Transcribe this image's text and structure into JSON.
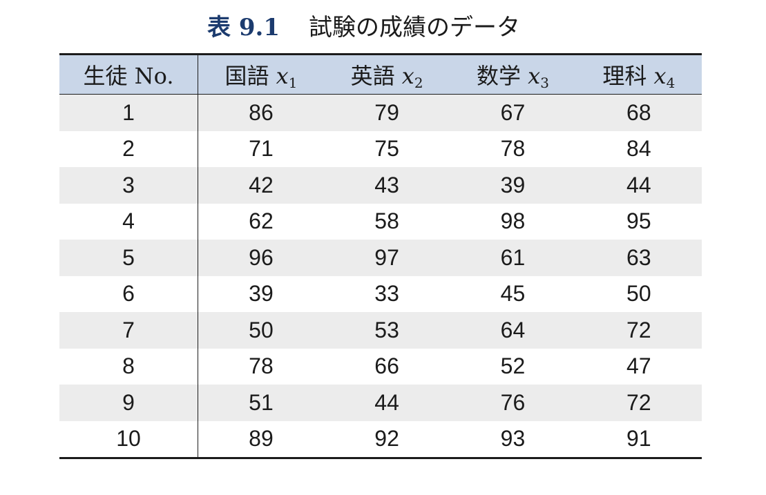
{
  "caption": {
    "label": "表",
    "number": "9.1",
    "title": "試験の成績のデータ"
  },
  "table": {
    "headers": [
      {
        "text": "生徒 No.",
        "var": "",
        "sub": ""
      },
      {
        "text": "国語 ",
        "var": "x",
        "sub": "1"
      },
      {
        "text": "英語 ",
        "var": "x",
        "sub": "2"
      },
      {
        "text": "数学 ",
        "var": "x",
        "sub": "3"
      },
      {
        "text": "理科 ",
        "var": "x",
        "sub": "4"
      }
    ],
    "rows": [
      [
        "1",
        "86",
        "79",
        "67",
        "68"
      ],
      [
        "2",
        "71",
        "75",
        "78",
        "84"
      ],
      [
        "3",
        "42",
        "43",
        "39",
        "44"
      ],
      [
        "4",
        "62",
        "58",
        "98",
        "95"
      ],
      [
        "5",
        "96",
        "97",
        "61",
        "63"
      ],
      [
        "6",
        "39",
        "33",
        "45",
        "50"
      ],
      [
        "7",
        "50",
        "53",
        "64",
        "72"
      ],
      [
        "8",
        "78",
        "66",
        "52",
        "47"
      ],
      [
        "9",
        "51",
        "44",
        "76",
        "72"
      ],
      [
        "10",
        "89",
        "92",
        "93",
        "91"
      ]
    ]
  },
  "colors": {
    "header_bg": "#c9d6e8",
    "stripe_bg": "#ececec",
    "caption_label": "#1c3b6e"
  }
}
